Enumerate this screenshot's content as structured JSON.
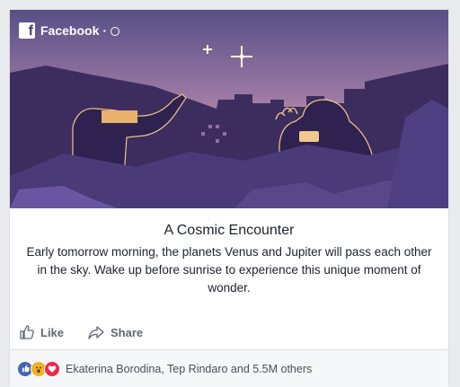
{
  "brand": {
    "name": "Facebook",
    "separator": "·",
    "logo_letter": "f"
  },
  "post": {
    "title": "A Cosmic Encounter",
    "description": "Early tomorrow morning, the planets Venus and Jupiter will pass each other in the sky. Wake up before sunrise to experience this unique moment of wonder."
  },
  "actions": {
    "like_label": "Like",
    "share_label": "Share"
  },
  "reactions": {
    "icons": [
      "like-icon",
      "wow-icon",
      "love-icon"
    ],
    "summary": "Ekaterina Borodina, Tep Rindaro and 5.5M others"
  },
  "colors": {
    "sky_top": "#574f86",
    "sky_glow": "#f0b97a",
    "silhouette": "#3c2d5e",
    "foreground": "#5a4789",
    "like_blue": "#4267b2"
  }
}
